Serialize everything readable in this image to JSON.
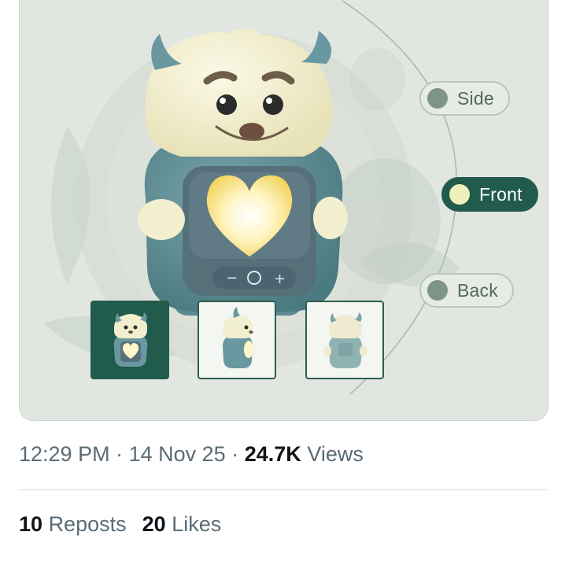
{
  "views": {
    "side": "Side",
    "front": "Front",
    "back": "Back",
    "selected": "Front"
  },
  "thumbnails": [
    "front-view-thumbnail",
    "side-view-thumbnail",
    "back-view-thumbnail"
  ],
  "post_meta": {
    "time": "12:29 PM",
    "separator": "·",
    "date": "14 Nov 25",
    "views_count": "24.7K",
    "views_label": "Views"
  },
  "engagement": {
    "reposts_count": "10",
    "reposts_label": "Reposts",
    "likes_count": "20",
    "likes_label": "Likes"
  },
  "colors": {
    "accent": "#215b4c",
    "toy_body": "#5f8e94",
    "toy_head": "#f2efcf",
    "heart_glow": "#fff6c8",
    "background": "#e1e6e1"
  }
}
